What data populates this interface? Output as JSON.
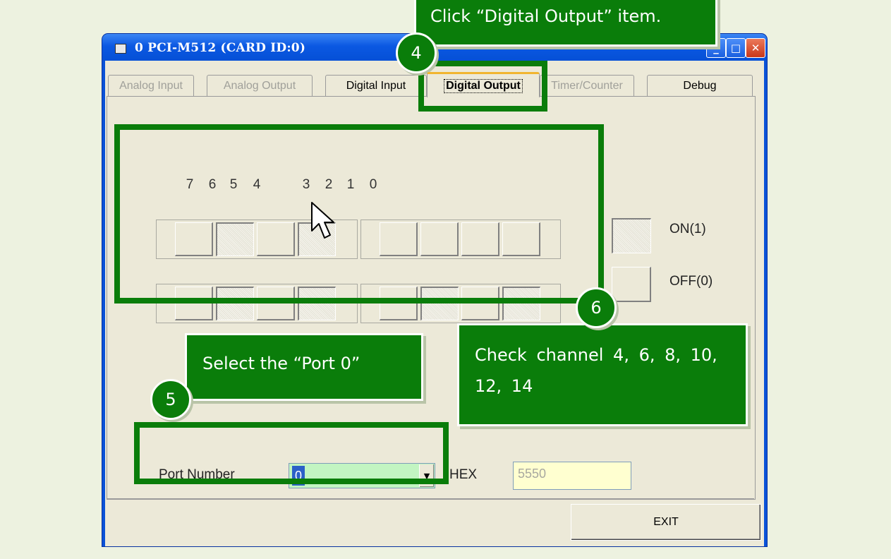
{
  "window": {
    "title": "0 PCI-M512 (CARD ID:0)",
    "buttons": [
      "_",
      "□",
      "✕"
    ]
  },
  "tabs": [
    {
      "label": "Analog Input",
      "state": "disabled"
    },
    {
      "label": "Analog Output",
      "state": "disabled"
    },
    {
      "label": "Digital Input",
      "state": "normal"
    },
    {
      "label": "Digital Output",
      "state": "active"
    },
    {
      "label": "Timer/Counter",
      "state": "disabled"
    },
    {
      "label": "Debug",
      "state": "normal"
    }
  ],
  "bits": {
    "headers": [
      "7",
      "6",
      "5",
      "4",
      "3",
      "2",
      "1",
      "0"
    ],
    "row1": [
      "off",
      "on",
      "off",
      "on",
      "off",
      "off",
      "off",
      "off"
    ],
    "row2": [
      "off",
      "on",
      "off",
      "on",
      "off",
      "on",
      "off",
      "on"
    ]
  },
  "legend": {
    "on_label": "ON(1)",
    "off_label": "OFF(0)"
  },
  "port": {
    "label": "Port Number",
    "value": "0"
  },
  "hex": {
    "label": "HEX",
    "value": "5550"
  },
  "exit_button": "EXIT",
  "annotations": {
    "callout4": "Click “Digital Output” item.",
    "badge4": "4",
    "callout5": "Select the “Port 0”",
    "badge5": "5",
    "callout6": "Check channel 4, 6, 8, 10, 12, 14",
    "badge6": "6"
  },
  "colors": {
    "annotation_green": "#0a7d0a",
    "title_blue": "#0b58e2",
    "page_bg": "#edf2e0",
    "port_select_bg": "#c2f5c2",
    "hex_bg": "#ffffd0"
  }
}
